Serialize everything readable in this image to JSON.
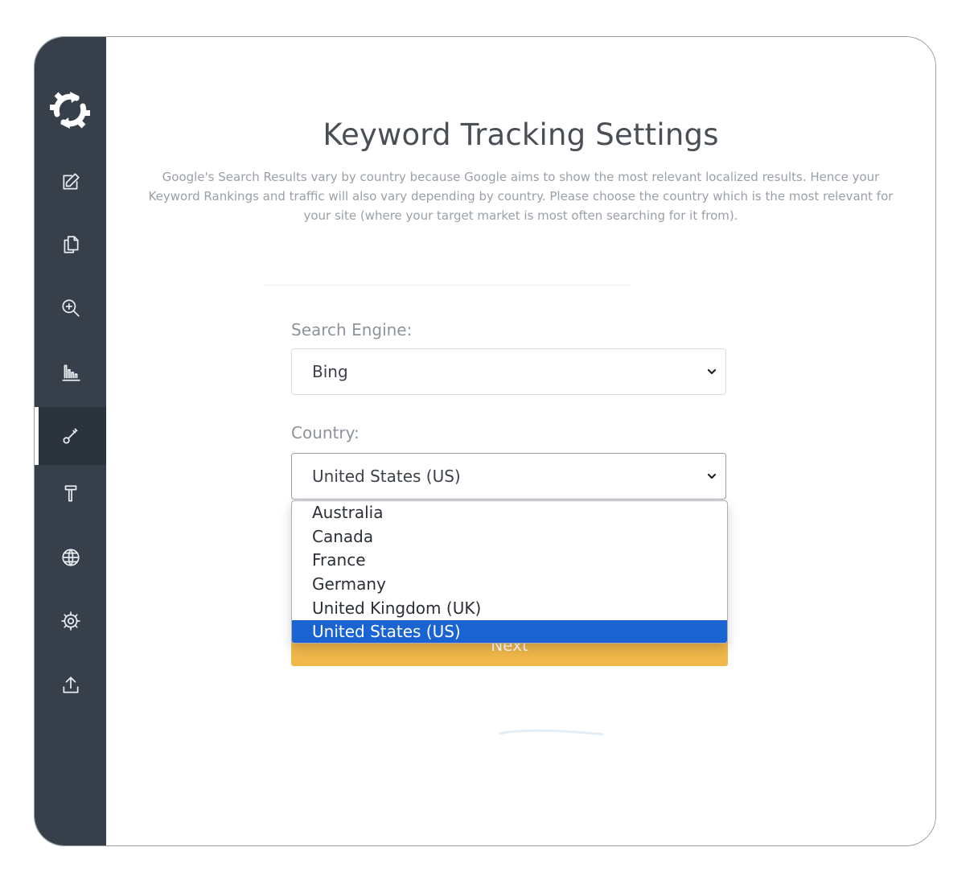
{
  "sidebar": {
    "items": [
      {
        "icon": "edit-icon"
      },
      {
        "icon": "copy-document-icon"
      },
      {
        "icon": "zoom-in-icon"
      },
      {
        "icon": "bar-chart-icon"
      },
      {
        "icon": "key-icon",
        "active": true
      },
      {
        "icon": "hammer-icon"
      },
      {
        "icon": "globe-icon"
      },
      {
        "icon": "gear-icon"
      },
      {
        "icon": "upload-icon"
      }
    ]
  },
  "page": {
    "title": "Keyword Tracking Settings",
    "description": "Google's Search Results vary by country because Google aims to show the most relevant localized results. Hence your Keyword Rankings and traffic will also vary depending by country. Please choose the country which is the most relevant for your site (where your target market is most often searching for it from)."
  },
  "form": {
    "search_engine_label": "Search Engine:",
    "search_engine_value": "Bing",
    "country_label": "Country:",
    "country_value": "United States (US)",
    "country_options": [
      "Australia",
      "Canada",
      "France",
      "Germany",
      "United Kingdom (UK)",
      "United States (US)"
    ],
    "selected_option": "United States (US)",
    "next_label": "Next"
  },
  "colors": {
    "sidebar_bg": "#363f4a",
    "accent_button": "#f0b84a",
    "selection_highlight": "#1a63d3"
  }
}
